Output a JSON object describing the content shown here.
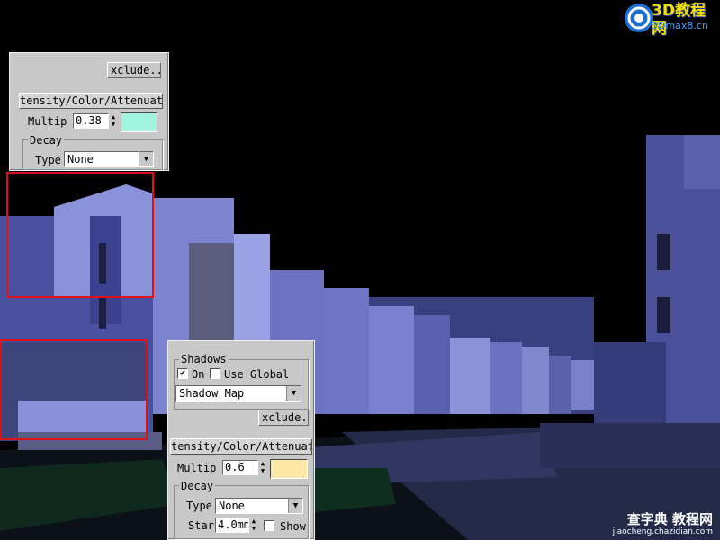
{
  "logo": {
    "main_text": "3D教程网",
    "sub_text": "3Dmax8.cn"
  },
  "watermark": {
    "main_text": "查字典 教程网",
    "sub_text": "jiaocheng.chazidian.com"
  },
  "panel_top": {
    "exclude_label": "xclude..",
    "rollout_title": "tensity/Color/Attenuati",
    "multiplier_label": "Multip",
    "multiplier_value": "0.38",
    "color_swatch": "#a0f4e0",
    "decay_group_label": "Decay",
    "type_label": "Type",
    "type_value": "None"
  },
  "panel_bottom": {
    "shadows_group_label": "Shadows",
    "on_label": "On",
    "on_checked": true,
    "use_global_label": "Use Global",
    "use_global_checked": false,
    "shadow_type_value": "Shadow Map",
    "exclude_label": "xclude..",
    "rollout_title": "tensity/Color/Attenuati",
    "multiplier_label": "Multip",
    "multiplier_value": "0.6",
    "color_swatch": "#fde8a8",
    "decay_group_label": "Decay",
    "type_label": "Type",
    "type_value": "None",
    "start_label": "Star",
    "start_value": "4.0mm",
    "show_label": "Show",
    "show_checked": false
  },
  "highlight_color": "#e0101a",
  "scene_palette": {
    "sky": "#000000",
    "building_light": "#8c94d8",
    "building_mid": "#5a60a8",
    "building_dark": "#2a2e60",
    "ground": "#1a2230"
  }
}
